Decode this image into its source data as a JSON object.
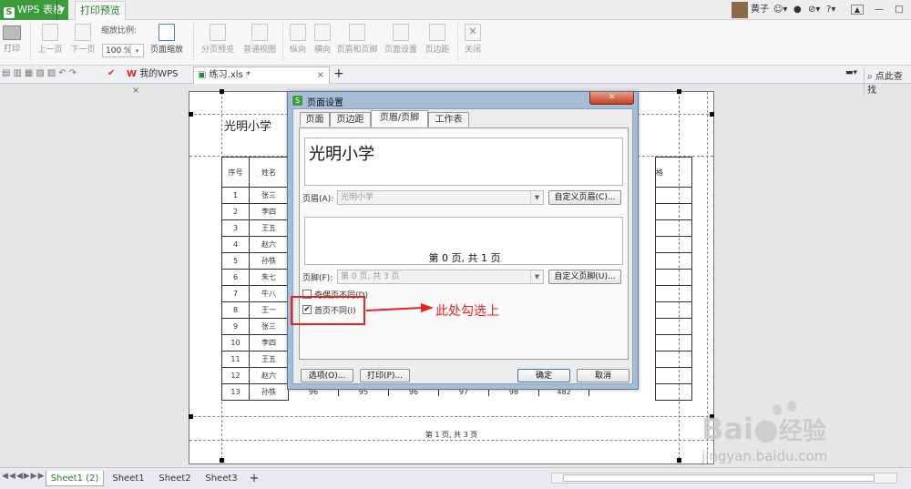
{
  "titlebar": {
    "app_name": "WPS 表格",
    "app_logo": "S",
    "active_tab": "打印预览",
    "user_name": "黄子",
    "help_label": "?"
  },
  "ribbon": {
    "print": "打印",
    "prev_page": "上一页",
    "next_page": "下一页",
    "zoom_label": "缩放比例:",
    "zoom_value": "100 %",
    "page_zoom": "页面缩放",
    "page_break_preview": "分页预览",
    "normal_view": "普通视图",
    "portrait": "纵向",
    "landscape": "横向",
    "header_footer": "页眉和页脚",
    "page_setup": "页面设置",
    "margins": "页边距",
    "close": "关闭"
  },
  "doc_tabs": {
    "my_wps": "我的WPS",
    "file_tab": "练习.xls *",
    "search": "点此查找"
  },
  "sheet_preview": {
    "header_text": "光明小学",
    "col_seq": "序号",
    "col_name": "姓名",
    "col_grade_partial": "格",
    "rows": [
      {
        "n": "1",
        "name": "张三"
      },
      {
        "n": "2",
        "name": "李四"
      },
      {
        "n": "3",
        "name": "王五"
      },
      {
        "n": "4",
        "name": "赵六"
      },
      {
        "n": "5",
        "name": "孙铁"
      },
      {
        "n": "6",
        "name": "朱七"
      },
      {
        "n": "7",
        "name": "牛八"
      },
      {
        "n": "8",
        "name": "王一"
      },
      {
        "n": "9",
        "name": "张三"
      },
      {
        "n": "10",
        "name": "李四"
      },
      {
        "n": "11",
        "name": "王五"
      },
      {
        "n": "12",
        "name": "赵六"
      },
      {
        "n": "13",
        "name": "孙铁"
      }
    ],
    "last_row_scores": [
      "96",
      "95",
      "96",
      "97",
      "98",
      "482"
    ],
    "footer_text": "第 1 页, 共 3 页"
  },
  "dialog": {
    "title": "页面设置",
    "tabs": [
      "页面",
      "页边距",
      "页眉/页脚",
      "工作表"
    ],
    "header_preview": "光明小学",
    "header_label": "页眉(A):",
    "header_value": "光明小学",
    "custom_header": "自定义页眉(C)...",
    "footer_preview": "第 0 页, 共 1 页",
    "footer_label": "页脚(F):",
    "footer_value": "第 0 页, 共 3 页",
    "custom_footer": "自定义页脚(U)...",
    "odd_even_label": "奇偶页不同(D)",
    "first_page_label": "首页不同(I)",
    "options_btn": "选项(O)...",
    "print_btn": "打印(P)...",
    "ok_btn": "确定",
    "cancel_btn": "取消",
    "close_glyph": "✕"
  },
  "annotation": {
    "text": "此处勾选上",
    "color": "#e8231e"
  },
  "sheet_tabs": [
    "Sheet1 (2)",
    "Sheet1",
    "Sheet2",
    "Sheet3"
  ],
  "add_sheet": "+",
  "watermark": {
    "brand": "Bai",
    "brand2": "经验",
    "url": "jingyan.baidu.com"
  }
}
